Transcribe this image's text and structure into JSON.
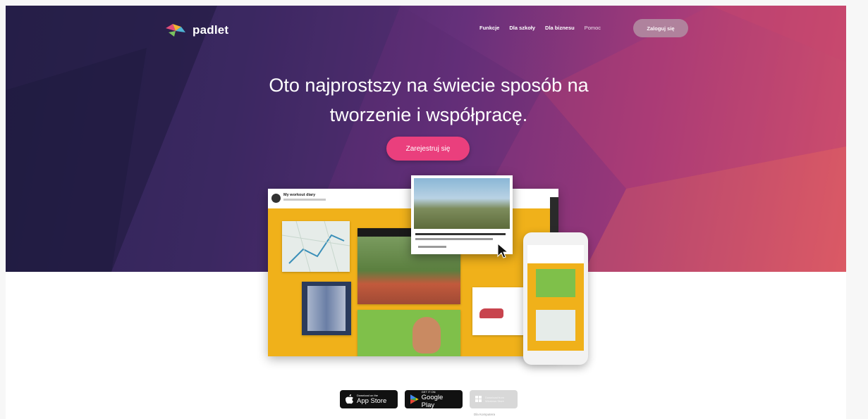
{
  "brand": {
    "name": "padlet"
  },
  "nav": {
    "items": [
      {
        "label": "Funkcje"
      },
      {
        "label": "Dla szkoły"
      },
      {
        "label": "Dla biznesu"
      },
      {
        "label": "Pomoc"
      }
    ],
    "login_label": "Zaloguj się"
  },
  "hero": {
    "headline_line1": "Oto najprostszy na świecie sposób na",
    "headline_line2": "tworzenie i współpracę.",
    "cta_label": "Zarejestruj się"
  },
  "mockup": {
    "board_title": "My workout diary"
  },
  "stores": {
    "app_store": {
      "small": "Download on the",
      "big": "App Store"
    },
    "google_play": {
      "small": "GET IT ON",
      "big": "Google Play"
    },
    "windows": {
      "small": "Download from",
      "big": "Windows Store"
    },
    "caption": "Dla Komputera"
  },
  "colors": {
    "cta": "#ea3f7d",
    "board": "#f0b11a",
    "hero_start": "#2a2450",
    "hero_end": "#d9566a"
  }
}
